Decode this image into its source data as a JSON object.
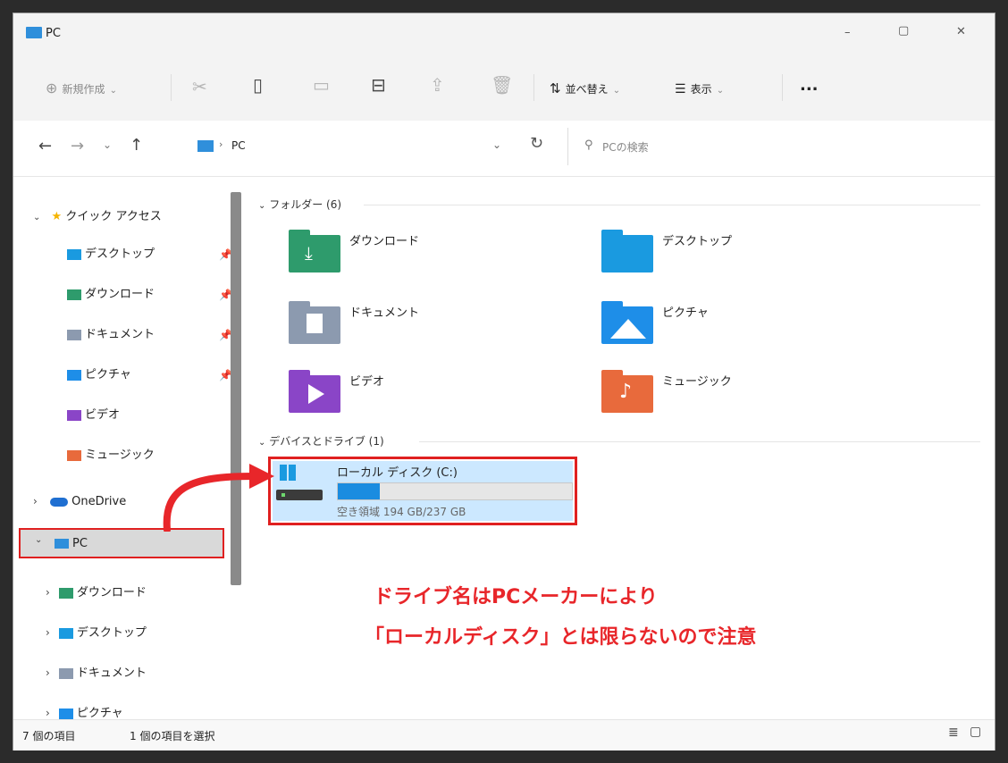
{
  "window": {
    "title": "PC",
    "controls": {
      "minimize": "–",
      "maximize": "▢",
      "close": "✕"
    }
  },
  "toolbar": {
    "new_label": "新規作成",
    "sort_label": "並べ替え",
    "view_label": "表示",
    "more_label": "..."
  },
  "address": {
    "path": "PC",
    "search_placeholder": "PCの検索"
  },
  "sidebar": {
    "quick_access": "クイック アクセス",
    "quick_items": [
      {
        "label": "デスクトップ",
        "icon": "desktop-folder-icon",
        "pinned": true
      },
      {
        "label": "ダウンロード",
        "icon": "download-folder-icon",
        "pinned": true
      },
      {
        "label": "ドキュメント",
        "icon": "documents-folder-icon",
        "pinned": true
      },
      {
        "label": "ピクチャ",
        "icon": "pictures-folder-icon",
        "pinned": true
      },
      {
        "label": "ビデオ",
        "icon": "videos-folder-icon",
        "pinned": false
      },
      {
        "label": "ミュージック",
        "icon": "music-folder-icon",
        "pinned": false
      }
    ],
    "onedrive": "OneDrive",
    "pc": "PC",
    "pc_children": [
      {
        "label": "ダウンロード",
        "icon": "download-folder-icon"
      },
      {
        "label": "デスクトップ",
        "icon": "desktop-folder-icon"
      },
      {
        "label": "ドキュメント",
        "icon": "documents-folder-icon"
      },
      {
        "label": "ピクチャ",
        "icon": "pictures-folder-icon"
      }
    ]
  },
  "main": {
    "folders_header": "フォルダー (6)",
    "folders": [
      {
        "label": "ダウンロード",
        "color": "#2e9b6c",
        "icon": "download-folder-icon"
      },
      {
        "label": "デスクトップ",
        "color": "#1a9ae0",
        "icon": "desktop-folder-icon"
      },
      {
        "label": "ドキュメント",
        "color": "#8c9aaf",
        "icon": "documents-folder-icon"
      },
      {
        "label": "ピクチャ",
        "color": "#1e8ee8",
        "icon": "pictures-folder-icon"
      },
      {
        "label": "ビデオ",
        "color": "#8a45c7",
        "icon": "videos-folder-icon"
      },
      {
        "label": "ミュージック",
        "color": "#e86a3c",
        "icon": "music-folder-icon"
      }
    ],
    "devices_header": "デバイスとドライブ (1)",
    "drive": {
      "name": "ローカル ディスク (C:)",
      "free_text": "空き領域 194 GB/237 GB",
      "used_fraction": 0.18
    }
  },
  "annotation": {
    "line1": "ドライブ名はPCメーカーにより",
    "line2": "「ローカルディスク」とは限らないので注意",
    "color": "#e8262a"
  },
  "status": {
    "count": "7 個の項目",
    "selected": "1 個の項目を選択"
  }
}
